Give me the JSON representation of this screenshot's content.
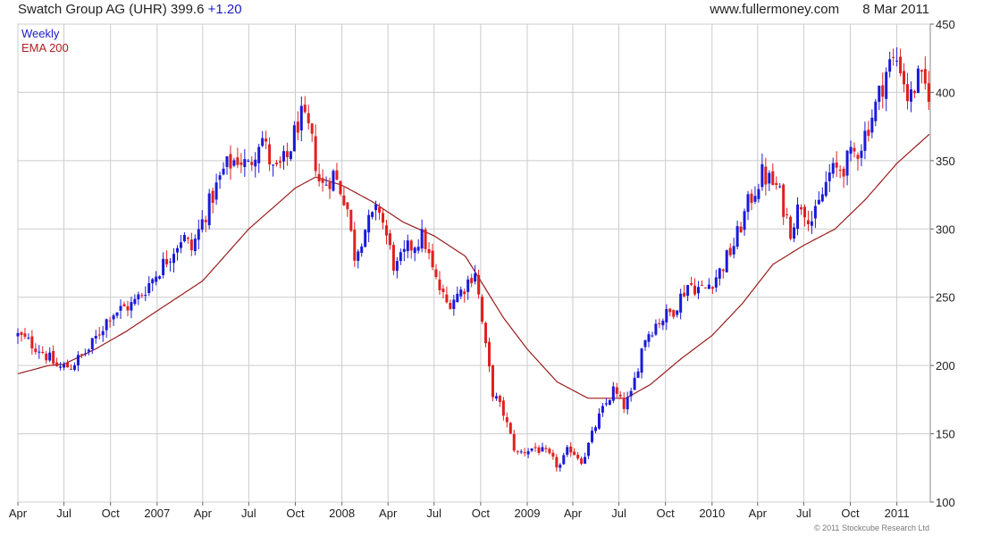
{
  "header": {
    "symbol": "Swatch Group AG (UHR)",
    "price": "399.6",
    "change": "+1.20",
    "website": "www.fullermoney.com",
    "date": "8 Mar 2011"
  },
  "legend": {
    "period": "Weekly",
    "ema": "EMA 200"
  },
  "copyright": "© 2011 Stockcube Research Ltd",
  "colors": {
    "up": "#1a1ad8",
    "down": "#e02020",
    "ema": "#9a1c1c",
    "grid": "#cccccc"
  },
  "chart_data": {
    "type": "candlestick",
    "y_axis": {
      "min": 100,
      "max": 450,
      "ticks": [
        100,
        150,
        200,
        250,
        300,
        350,
        400,
        450
      ],
      "side": "right"
    },
    "x_axis": {
      "start": "2006-04-01",
      "end": "2011-03-08",
      "ticks": [
        {
          "label": "Apr",
          "date": "2006-04-01"
        },
        {
          "label": "Jul",
          "date": "2006-07-01"
        },
        {
          "label": "Oct",
          "date": "2006-10-01"
        },
        {
          "label": "2007",
          "date": "2007-01-01"
        },
        {
          "label": "Apr",
          "date": "2007-04-01"
        },
        {
          "label": "Jul",
          "date": "2007-07-01"
        },
        {
          "label": "Oct",
          "date": "2007-10-01"
        },
        {
          "label": "2008",
          "date": "2008-01-01"
        },
        {
          "label": "Apr",
          "date": "2008-04-01"
        },
        {
          "label": "Jul",
          "date": "2008-07-01"
        },
        {
          "label": "Oct",
          "date": "2008-10-01"
        },
        {
          "label": "2009",
          "date": "2009-01-01"
        },
        {
          "label": "Apr",
          "date": "2009-04-01"
        },
        {
          "label": "Jul",
          "date": "2009-07-01"
        },
        {
          "label": "Oct",
          "date": "2009-10-01"
        },
        {
          "label": "2010",
          "date": "2010-01-01"
        },
        {
          "label": "Apr",
          "date": "2010-04-01"
        },
        {
          "label": "Jul",
          "date": "2010-07-01"
        },
        {
          "label": "Oct",
          "date": "2010-10-01"
        },
        {
          "label": "2011",
          "date": "2011-01-01"
        }
      ]
    },
    "grid": true,
    "price_path": [
      [
        "2006-04-01",
        222
      ],
      [
        "2006-05-15",
        212
      ],
      [
        "2006-06-20",
        198
      ],
      [
        "2006-07-15",
        200
      ],
      [
        "2006-08-20",
        212
      ],
      [
        "2006-10-01",
        238
      ],
      [
        "2006-11-15",
        245
      ],
      [
        "2006-12-20",
        262
      ],
      [
        "2007-01-20",
        278
      ],
      [
        "2007-02-20",
        295
      ],
      [
        "2007-03-10",
        285
      ],
      [
        "2007-04-10",
        315
      ],
      [
        "2007-05-15",
        345
      ],
      [
        "2007-06-10",
        352
      ],
      [
        "2007-07-01",
        345
      ],
      [
        "2007-07-25",
        370
      ],
      [
        "2007-08-20",
        340
      ],
      [
        "2007-09-15",
        352
      ],
      [
        "2007-10-10",
        383
      ],
      [
        "2007-10-30",
        370
      ],
      [
        "2007-11-20",
        330
      ],
      [
        "2007-12-15",
        340
      ],
      [
        "2008-01-10",
        320
      ],
      [
        "2008-01-25",
        280
      ],
      [
        "2008-02-15",
        300
      ],
      [
        "2008-03-15",
        315
      ],
      [
        "2008-04-15",
        270
      ],
      [
        "2008-05-10",
        285
      ],
      [
        "2008-06-10",
        295
      ],
      [
        "2008-07-01",
        265
      ],
      [
        "2008-07-25",
        245
      ],
      [
        "2008-08-25",
        255
      ],
      [
        "2008-09-20",
        270
      ],
      [
        "2008-10-10",
        215
      ],
      [
        "2008-10-25",
        180
      ],
      [
        "2008-11-15",
        165
      ],
      [
        "2008-12-10",
        135
      ],
      [
        "2009-01-15",
        140
      ],
      [
        "2009-02-10",
        135
      ],
      [
        "2009-03-05",
        125
      ],
      [
        "2009-03-25",
        140
      ],
      [
        "2009-04-20",
        130
      ],
      [
        "2009-05-20",
        160
      ],
      [
        "2009-06-20",
        182
      ],
      [
        "2009-07-10",
        170
      ],
      [
        "2009-07-25",
        178
      ],
      [
        "2009-08-20",
        220
      ],
      [
        "2009-09-15",
        232
      ],
      [
        "2009-10-15",
        240
      ],
      [
        "2009-11-15",
        260
      ],
      [
        "2009-12-15",
        255
      ],
      [
        "2010-01-15",
        268
      ],
      [
        "2010-02-15",
        290
      ],
      [
        "2010-03-15",
        320
      ],
      [
        "2010-04-10",
        340
      ],
      [
        "2010-05-10",
        330
      ],
      [
        "2010-06-05",
        300
      ],
      [
        "2010-06-25",
        320
      ],
      [
        "2010-07-20",
        305
      ],
      [
        "2010-08-20",
        340
      ],
      [
        "2010-09-15",
        345
      ],
      [
        "2010-10-20",
        360
      ],
      [
        "2010-11-20",
        390
      ],
      [
        "2010-12-15",
        420
      ],
      [
        "2011-01-05",
        425
      ],
      [
        "2011-01-25",
        392
      ],
      [
        "2011-02-10",
        410
      ],
      [
        "2011-03-08",
        399.6
      ]
    ],
    "ema_path": [
      [
        "2006-04-01",
        194
      ],
      [
        "2006-06-01",
        200
      ],
      [
        "2006-07-01",
        201
      ],
      [
        "2006-09-01",
        212
      ],
      [
        "2006-11-01",
        225
      ],
      [
        "2007-01-01",
        240
      ],
      [
        "2007-04-01",
        262
      ],
      [
        "2007-07-01",
        300
      ],
      [
        "2007-10-01",
        330
      ],
      [
        "2007-11-10",
        338
      ],
      [
        "2008-01-01",
        332
      ],
      [
        "2008-03-01",
        320
      ],
      [
        "2008-05-01",
        305
      ],
      [
        "2008-07-01",
        295
      ],
      [
        "2008-09-01",
        280
      ],
      [
        "2008-10-01",
        262
      ],
      [
        "2008-11-15",
        235
      ],
      [
        "2009-01-01",
        212
      ],
      [
        "2009-03-01",
        188
      ],
      [
        "2009-05-01",
        176
      ],
      [
        "2009-07-15",
        176
      ],
      [
        "2009-09-01",
        186
      ],
      [
        "2009-11-01",
        205
      ],
      [
        "2010-01-01",
        222
      ],
      [
        "2010-03-01",
        245
      ],
      [
        "2010-05-01",
        274
      ],
      [
        "2010-07-01",
        288
      ],
      [
        "2010-09-01",
        300
      ],
      [
        "2010-11-01",
        322
      ],
      [
        "2011-01-01",
        348
      ],
      [
        "2011-03-08",
        370
      ]
    ]
  }
}
